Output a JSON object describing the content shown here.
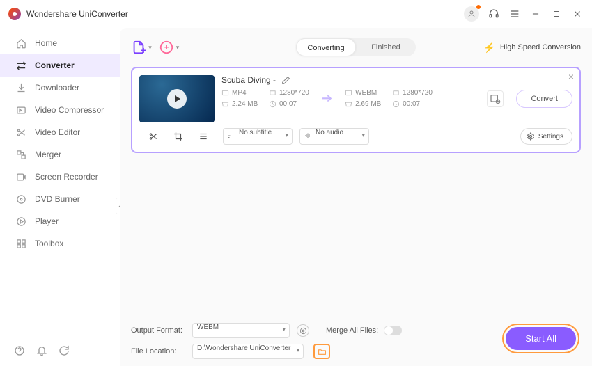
{
  "app": {
    "title": "Wondershare UniConverter"
  },
  "sidebar": {
    "items": [
      {
        "label": "Home"
      },
      {
        "label": "Converter"
      },
      {
        "label": "Downloader"
      },
      {
        "label": "Video Compressor"
      },
      {
        "label": "Video Editor"
      },
      {
        "label": "Merger"
      },
      {
        "label": "Screen Recorder"
      },
      {
        "label": "DVD Burner"
      },
      {
        "label": "Player"
      },
      {
        "label": "Toolbox"
      }
    ]
  },
  "tabs": {
    "converting": "Converting",
    "finished": "Finished"
  },
  "hispeed": "High Speed Conversion",
  "task": {
    "title": "Scuba Diving -",
    "src": {
      "format": "MP4",
      "res": "1280*720",
      "size": "2.24 MB",
      "dur": "00:07"
    },
    "dst": {
      "format": "WEBM",
      "res": "1280*720",
      "size": "2.69 MB",
      "dur": "00:07"
    },
    "subtitle": "No subtitle",
    "audio": "No audio",
    "settings": "Settings",
    "convert": "Convert"
  },
  "bottom": {
    "outfmt_label": "Output Format:",
    "outfmt": "WEBM",
    "merge_label": "Merge All Files:",
    "loc_label": "File Location:",
    "loc": "D:\\Wondershare UniConverter",
    "start": "Start All"
  }
}
